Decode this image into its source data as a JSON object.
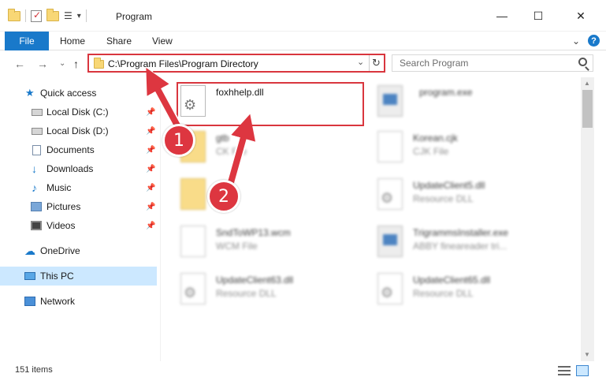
{
  "window": {
    "title": "Program",
    "minimize_glyph": "—",
    "maximize_glyph": "☐",
    "close_glyph": "✕",
    "expand_ribbon_glyph": "⌄",
    "help_glyph": "?"
  },
  "quick_access_toolbar": {
    "customize_glyph": "▾"
  },
  "ribbon": {
    "file_tab": "File",
    "tabs": [
      "Home",
      "Share",
      "View"
    ]
  },
  "nav": {
    "back_glyph": "←",
    "forward_glyph": "→",
    "recent_glyph": "⌄",
    "up_glyph": "↑",
    "address": "C:\\Program Files\\Program Directory",
    "address_dropdown_glyph": "⌄",
    "refresh_glyph": "↻",
    "search_placeholder": "Search Program"
  },
  "sidebar": {
    "items": [
      {
        "label": "Quick access",
        "icon": "star-icon",
        "pinned": false
      },
      {
        "label": "Local Disk (C:)",
        "icon": "drive-icon",
        "pinned": true
      },
      {
        "label": "Local Disk (D:)",
        "icon": "drive-icon",
        "pinned": true
      },
      {
        "label": "Documents",
        "icon": "documents-icon",
        "pinned": true
      },
      {
        "label": "Downloads",
        "icon": "download-icon",
        "pinned": true
      },
      {
        "label": "Music",
        "icon": "music-icon",
        "pinned": true
      },
      {
        "label": "Pictures",
        "icon": "pictures-icon",
        "pinned": true
      },
      {
        "label": "Videos",
        "icon": "videos-icon",
        "pinned": true
      },
      {
        "label": "OneDrive",
        "icon": "cloud-icon",
        "pinned": false
      },
      {
        "label": "This PC",
        "icon": "computer-icon",
        "pinned": false,
        "selected": true
      },
      {
        "label": "Network",
        "icon": "network-icon",
        "pinned": false
      }
    ],
    "pin_glyph": "📌"
  },
  "files": [
    {
      "name": "foxhhelp.dll",
      "type": "",
      "icon": "dll-file-icon",
      "highlighted": true
    },
    {
      "name": "program.exe",
      "type": "",
      "icon": "exe-file-icon"
    },
    {
      "name": "gtb",
      "type": "CK File",
      "icon": "folder-icon"
    },
    {
      "name": "Korean.cjk",
      "type": "CJK File",
      "icon": "file-icon"
    },
    {
      "name": "",
      "type": "",
      "icon": "folder-icon"
    },
    {
      "name": "UpdateClient5.dll",
      "type": "Resource DLL",
      "icon": "dll-file-icon"
    },
    {
      "name": "SndToWP13.wcm",
      "type": "WCM File",
      "icon": "file-icon"
    },
    {
      "name": "TrigrammsInstaller.exe",
      "type": "ABBY fineareader tri...",
      "icon": "exe-file-icon"
    },
    {
      "name": "UpdateClient63.dll",
      "type": "Resource DLL",
      "icon": "dll-file-icon"
    },
    {
      "name": "UpdateClient65.dll",
      "type": "Resource DLL",
      "icon": "dll-file-icon"
    }
  ],
  "status": {
    "item_count": "151 items"
  },
  "callouts": [
    "1",
    "2"
  ],
  "colors": {
    "accent": "#1979ca",
    "highlight_red": "#d9363e",
    "selected_bg": "#cce8ff"
  }
}
